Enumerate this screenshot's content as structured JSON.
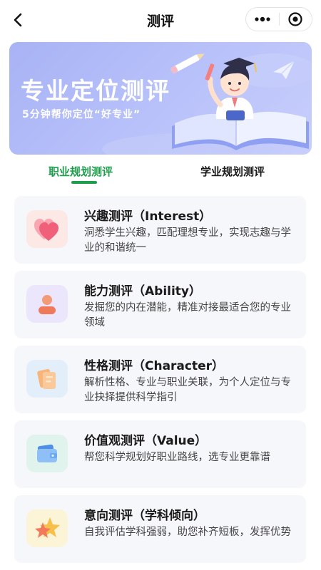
{
  "nav": {
    "title": "测评",
    "back_icon": "chevron-left-icon",
    "more_icon": "more-dots-icon",
    "close_icon": "target-circle-icon"
  },
  "banner": {
    "title": "专业定位测评",
    "subtitle": "5分钟帮你定位“好专业”"
  },
  "tabs": [
    {
      "label": "职业规划测评",
      "active": true
    },
    {
      "label": "学业规划测评",
      "active": false
    }
  ],
  "cards": [
    {
      "title": "兴趣测评（Interest）",
      "desc": "洞悉学生兴趣，匹配理想专业，实现志趣与学业的和谐统一",
      "icon": "heart-icon",
      "icon_bg": "#fce8e4",
      "icon_color": "#f0607a"
    },
    {
      "title": "能力测评（Ability）",
      "desc": "发掘您的内在潜能，精准对接最适合您的专业领域",
      "icon": "person-icon",
      "icon_bg": "#ebe6fb",
      "icon_color": "#f08a6a"
    },
    {
      "title": "性格测评（Character）",
      "desc": "解析性格、专业与职业关联，为个人定位与专业抉择提供科学指引",
      "icon": "cards-icon",
      "icon_bg": "#e2eefa",
      "icon_color": "#f5a05a"
    },
    {
      "title": "价值观测评（Value）",
      "desc": "帮您科学规划好职业路线，选专业更靠谱",
      "icon": "wallet-icon",
      "icon_bg": "#e0f3ec",
      "icon_color": "#6aa8f2"
    },
    {
      "title": "意向测评（学科倾向）",
      "desc": "自我评估学科强弱，助您补齐短板，发挥优势",
      "icon": "star-icon",
      "icon_bg": "#fcf4d6",
      "icon_color": "#f27a5a"
    }
  ],
  "colors": {
    "accent": "#1e9e4c",
    "banner": "#b0baf7"
  }
}
